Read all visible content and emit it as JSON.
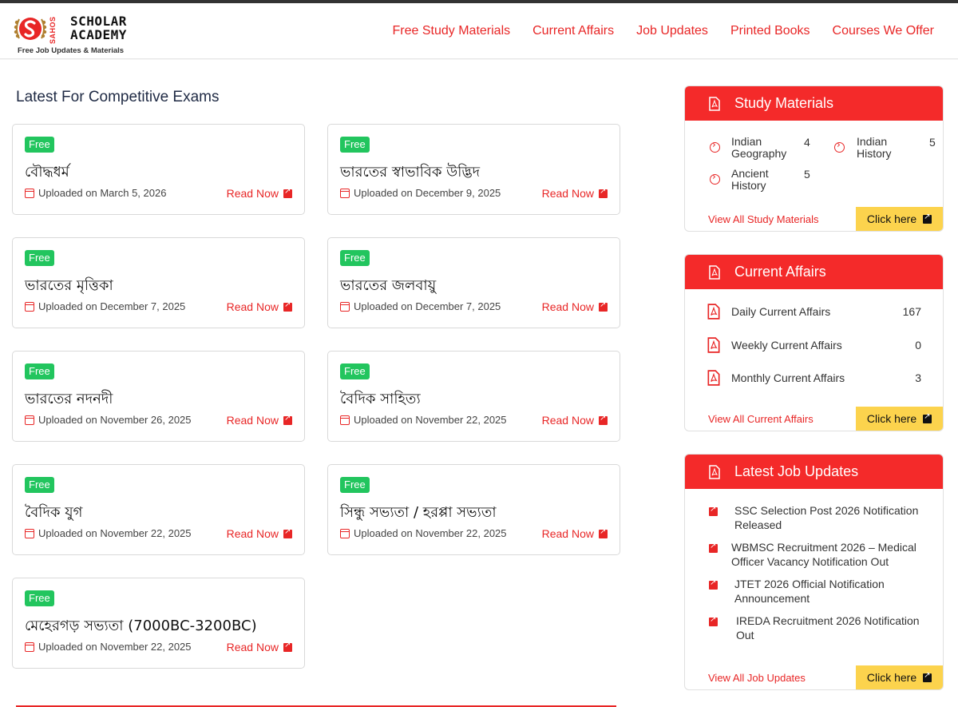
{
  "header": {
    "brand_line1": "SCHOLAR",
    "brand_line2": "ACADEMY",
    "brand_side": "SAHOS",
    "tagline": "Free Job Updates & Materials",
    "nav": [
      {
        "label": "Free Study Materials"
      },
      {
        "label": "Current Affairs"
      },
      {
        "label": "Job Updates"
      },
      {
        "label": "Printed Books"
      },
      {
        "label": "Courses We Offer"
      }
    ]
  },
  "main": {
    "section_title": "Latest For Competitive Exams",
    "cards": [
      {
        "badge": "Free",
        "title": "বৌদ্ধধর্ম",
        "uploaded": "Uploaded on March 5, 2026",
        "action": "Read Now"
      },
      {
        "badge": "Free",
        "title": "ভারতের স্বাভাবিক উদ্ভিদ",
        "uploaded": "Uploaded on December 9, 2025",
        "action": "Read Now"
      },
      {
        "badge": "Free",
        "title": "ভারতের মৃত্তিকা",
        "uploaded": "Uploaded on December 7, 2025",
        "action": "Read Now"
      },
      {
        "badge": "Free",
        "title": "ভারতের জলবায়ু",
        "uploaded": "Uploaded on December 7, 2025",
        "action": "Read Now"
      },
      {
        "badge": "Free",
        "title": "ভারতের নদনদী",
        "uploaded": "Uploaded on November 26, 2025",
        "action": "Read Now"
      },
      {
        "badge": "Free",
        "title": "বৈদিক সাহিত্য",
        "uploaded": "Uploaded on November 22, 2025",
        "action": "Read Now"
      },
      {
        "badge": "Free",
        "title": "বৈদিক যুগ",
        "uploaded": "Uploaded on November 22, 2025",
        "action": "Read Now"
      },
      {
        "badge": "Free",
        "title": "সিন্ধু সভ্যতা / হরপ্পা সভ্যতা",
        "uploaded": "Uploaded on November 22, 2025",
        "action": "Read Now"
      },
      {
        "badge": "Free",
        "title": "মেহেরগড় সভ্যতা (7000BC-3200BC)",
        "uploaded": "Uploaded on November 22, 2025",
        "action": "Read Now"
      }
    ]
  },
  "sidebar": {
    "study_materials": {
      "title": "Study Materials",
      "items": [
        {
          "label_line1": "Indian",
          "label_line2": "Geography",
          "count": "4"
        },
        {
          "label_line1": "Indian",
          "label_line2": "History",
          "count": "5"
        },
        {
          "label_line1": "Ancient",
          "label_line2": "History",
          "count": "5"
        }
      ],
      "view_all": "View All Study Materials",
      "click_here": "Click here"
    },
    "current_affairs": {
      "title": "Current Affairs",
      "items": [
        {
          "label": "Daily Current Affairs",
          "count": "167"
        },
        {
          "label": "Weekly Current Affairs",
          "count": "0"
        },
        {
          "label": "Monthly Current Affairs",
          "count": "3"
        }
      ],
      "view_all": "View All Current Affairs",
      "click_here": "Click here"
    },
    "job_updates": {
      "title": "Latest Job Updates",
      "items": [
        {
          "line1": "SSC Selection Post 2026 Notification",
          "line2": "Released"
        },
        {
          "line1": "WBMSC Recruitment 2026 – Medical",
          "line2": "Officer Vacancy Notification Out"
        },
        {
          "line1": "JTET 2026 Official Notification",
          "line2": "Announcement"
        },
        {
          "line1": "IREDA Recruitment 2026 Notification",
          "line2": "Out"
        }
      ],
      "view_all": "View All Job Updates",
      "click_here": "Click here"
    }
  },
  "colors": {
    "accent": "#e82626",
    "panel_header": "#f42a2a",
    "badge": "#22c55e",
    "cta": "#fcd34d"
  }
}
